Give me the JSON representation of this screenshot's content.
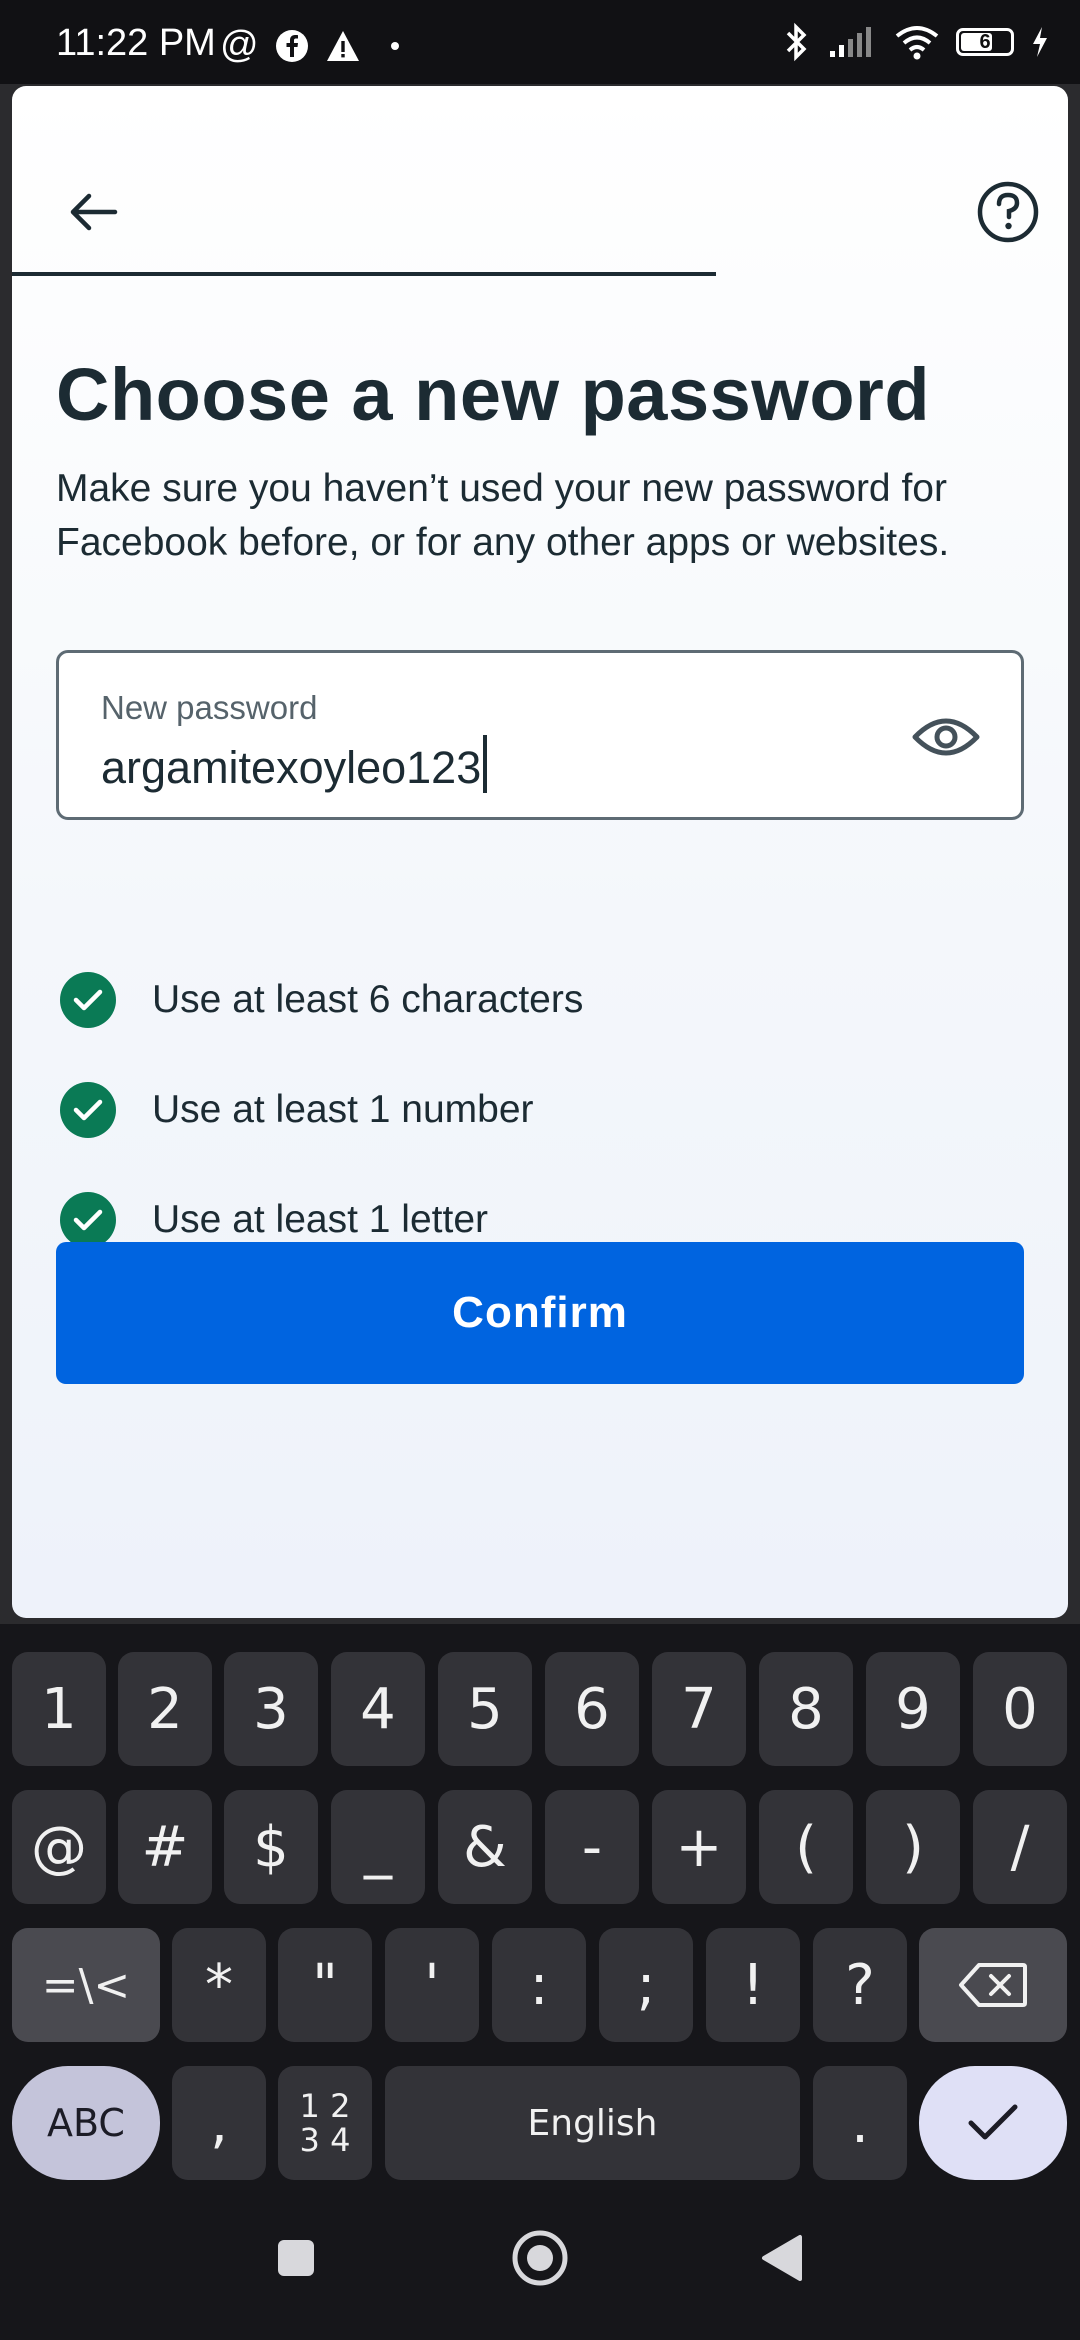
{
  "status_bar": {
    "time": "11:22 PM",
    "battery_level": "6"
  },
  "header": {
    "back_icon": "arrow-left-icon",
    "help_icon": "question-circle-icon"
  },
  "content": {
    "title": "Choose a new password",
    "description": "Make sure you haven’t used your new password for Facebook before, or for any other apps or websites.",
    "password_field": {
      "label": "New password",
      "value": "argamitexoyleo123"
    },
    "requirements": [
      {
        "text": "Use at least 6 characters",
        "met": true
      },
      {
        "text": "Use at least 1 number",
        "met": true
      },
      {
        "text": "Use at least 1 letter",
        "met": true
      }
    ],
    "confirm_label": "Confirm"
  },
  "keyboard": {
    "row1": [
      "1",
      "2",
      "3",
      "4",
      "5",
      "6",
      "7",
      "8",
      "9",
      "0"
    ],
    "row2": [
      "@",
      "#",
      "$",
      "_",
      "&",
      "-",
      "+",
      "(",
      ")",
      "/"
    ],
    "row3": [
      "=\\<",
      "*",
      "\"",
      "'",
      ":",
      ";",
      "!",
      "?"
    ],
    "abc_label": "ABC",
    "comma": ",",
    "numpad_label_top": "1 2",
    "numpad_label_bottom": "3 4",
    "space_label": "English",
    "period": "."
  },
  "colors": {
    "accent": "#0064e0",
    "check_green": "#0a7a55",
    "text_primary": "#1c2b33"
  }
}
